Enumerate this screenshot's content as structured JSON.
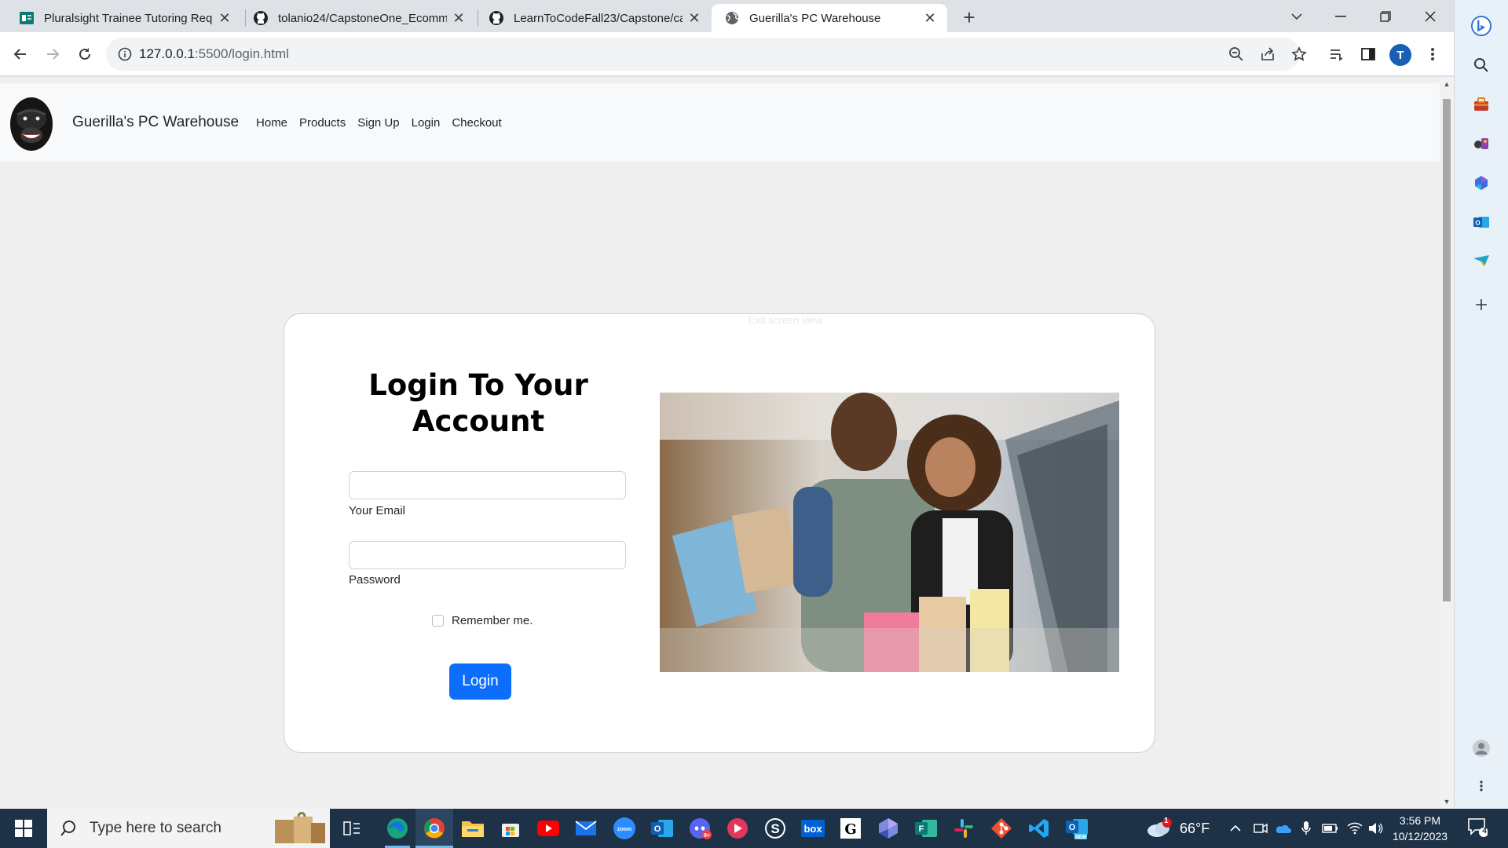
{
  "browser": {
    "tabs": [
      {
        "title": "Pluralsight Trainee Tutoring Req",
        "favicon": "forms-icon"
      },
      {
        "title": "tolanio24/CapstoneOne_Ecomm",
        "favicon": "github-icon"
      },
      {
        "title": "LearnToCodeFall23/Capstone/ca",
        "favicon": "github-icon"
      },
      {
        "title": "Guerilla's PC Warehouse",
        "favicon": "globe-icon",
        "active": true
      }
    ],
    "url_host": "127.0.0.1",
    "url_rest": ":5500/login.html",
    "profile_initial": "T"
  },
  "site": {
    "brand": "Guerilla's PC Warehouse",
    "nav": [
      "Home",
      "Products",
      "Sign Up",
      "Login",
      "Checkout"
    ]
  },
  "login": {
    "title": "Login To Your Account",
    "email_label": "Your Email",
    "email_value": "",
    "password_label": "Password",
    "password_value": "",
    "remember_label": "Remember me.",
    "remember_checked": false,
    "button_label": "Login",
    "ghost_text": "Exit screen view"
  },
  "taskbar": {
    "search_placeholder": "Type here to search",
    "weather": "66°F",
    "time": "3:56 PM",
    "date": "10/12/2023",
    "notifications": "4",
    "weather_badge": "1"
  },
  "colors": {
    "primary_button": "#0d6efd",
    "taskbar": "#1d3147",
    "edge_sidebar": "#e9f1f8"
  }
}
